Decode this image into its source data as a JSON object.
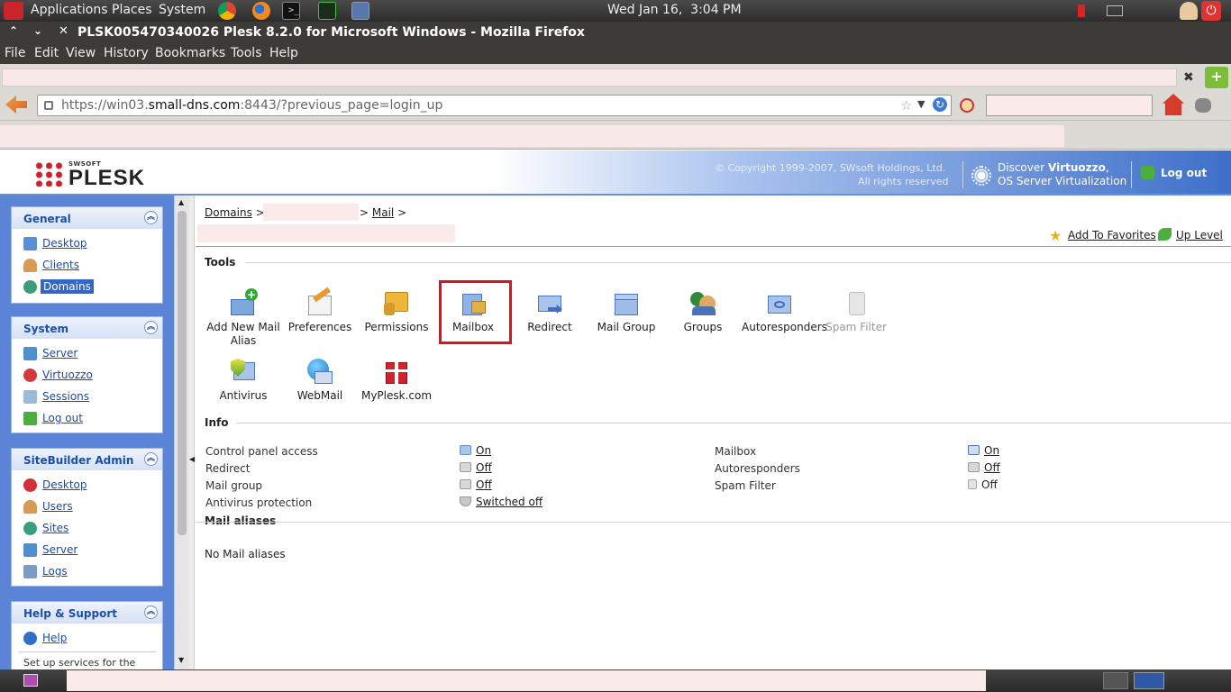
{
  "system_panel": {
    "menus": [
      "Applications",
      "Places",
      "System"
    ],
    "clock": "Wed Jan 16,  3:04 PM"
  },
  "browser": {
    "window_title": "PLSK005470340026 Plesk 8.2.0 for Microsoft Windows - Mozilla Firefox",
    "menu": [
      "File",
      "Edit",
      "View",
      "History",
      "Bookmarks",
      "Tools",
      "Help"
    ],
    "url_prefix": "https://win03.",
    "url_domain": "small-dns.com",
    "url_suffix": ":8443/?previous_page=login_up"
  },
  "header": {
    "logo_small": "SWSOFT",
    "logo": "PLESK",
    "copyright_line1": "© Copyright 1999-2007, SWsoft Holdings, Ltd.",
    "copyright_line2": "All rights reserved",
    "discover_prefix": "Discover ",
    "discover_bold": "Virtuozzo",
    "discover_suffix": ",",
    "discover_line2": "OS Server Virtualization",
    "logout": "Log out"
  },
  "sidebar": {
    "general": {
      "title": "General",
      "items": [
        {
          "label": "Desktop",
          "icon": "desktop-icon"
        },
        {
          "label": "Clients",
          "icon": "clients-icon"
        },
        {
          "label": "Domains",
          "icon": "domains-icon",
          "selected": true
        }
      ]
    },
    "system": {
      "title": "System",
      "items": [
        {
          "label": "Server",
          "icon": "server-icon"
        },
        {
          "label": "Virtuozzo",
          "icon": "virtuozzo-icon"
        },
        {
          "label": "Sessions",
          "icon": "sessions-icon"
        },
        {
          "label": "Log out",
          "icon": "logout-icon"
        }
      ]
    },
    "sitebuilder": {
      "title": "SiteBuilder Admin",
      "items": [
        {
          "label": "Desktop",
          "icon": "desktop-icon"
        },
        {
          "label": "Users",
          "icon": "users-icon"
        },
        {
          "label": "Sites",
          "icon": "sites-icon"
        },
        {
          "label": "Server",
          "icon": "server-icon"
        },
        {
          "label": "Logs",
          "icon": "logs-icon"
        }
      ]
    },
    "help": {
      "title": "Help & Support",
      "items": [
        {
          "label": "Help",
          "icon": "help-icon"
        }
      ],
      "note": "Set up services for the"
    }
  },
  "main": {
    "breadcrumb": {
      "domains": "Domains",
      "sep1": ">",
      "mail": "Mail",
      "sep2": ">",
      "sep3": ">"
    },
    "add_to_favorites": "Add To Favorites",
    "up_level": "Up Level",
    "tools_title": "Tools",
    "tools": [
      {
        "label": "Add New Mail Alias",
        "icon": "add-mail-alias-icon"
      },
      {
        "label": "Preferences",
        "icon": "preferences-icon"
      },
      {
        "label": "Permissions",
        "icon": "permissions-icon"
      },
      {
        "label": "Mailbox",
        "icon": "mailbox-icon",
        "highlighted": true
      },
      {
        "label": "Redirect",
        "icon": "redirect-icon"
      },
      {
        "label": "Mail Group",
        "icon": "mail-group-icon"
      },
      {
        "label": "Groups",
        "icon": "groups-icon"
      },
      {
        "label": "Autoresponders",
        "icon": "autoresponders-icon"
      },
      {
        "label": "Spam Filter",
        "icon": "spam-filter-icon",
        "disabled": true
      },
      {
        "label": "Antivirus",
        "icon": "antivirus-icon"
      },
      {
        "label": "WebMail",
        "icon": "webmail-icon"
      },
      {
        "label": "MyPlesk.com",
        "icon": "myplesk-icon"
      }
    ],
    "info_title": "Info",
    "info": {
      "control_panel_access": {
        "label": "Control panel access",
        "value": "On"
      },
      "redirect": {
        "label": "Redirect",
        "value": "Off"
      },
      "mail_group": {
        "label": "Mail group",
        "value": "Off"
      },
      "antivirus": {
        "label": "Antivirus protection",
        "value": "Switched off"
      },
      "mailbox": {
        "label": "Mailbox",
        "value": "On"
      },
      "autoresponders": {
        "label": "Autoresponders",
        "value": "Off"
      },
      "spam_filter": {
        "label": "Spam Filter",
        "value": "Off"
      }
    },
    "aliases_title": "Mail aliases",
    "aliases_empty": "No Mail aliases"
  },
  "colors": {
    "accent": "#3666c4",
    "highlight": "#e0111b",
    "sidebar": "#5b83d6"
  }
}
